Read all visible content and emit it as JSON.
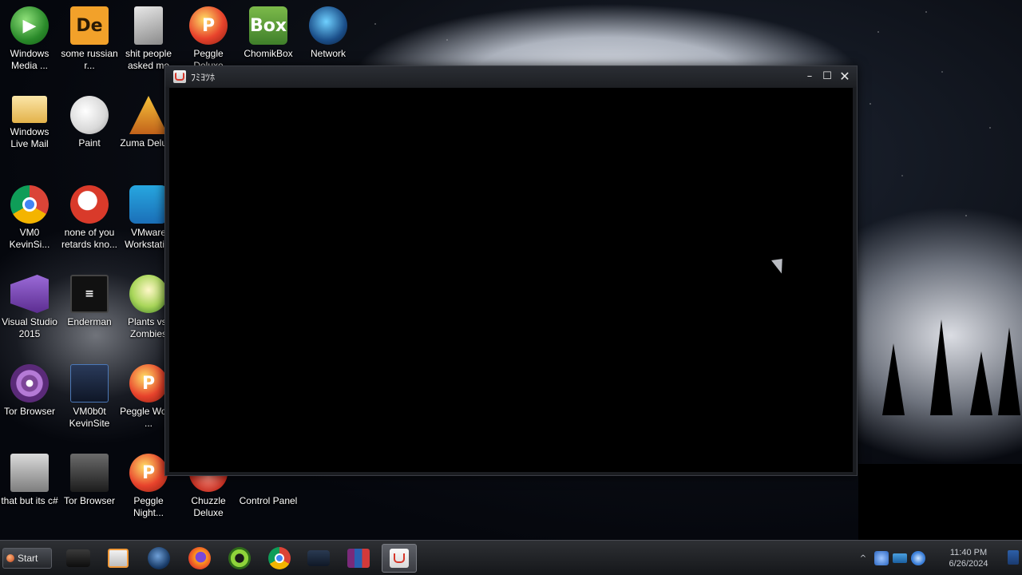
{
  "desktop": {
    "icons": [
      {
        "label": "Windows Media ...",
        "icon": "windows-media-player-icon"
      },
      {
        "label": "some russian r...",
        "icon": "de-app-icon"
      },
      {
        "label": "shit people asked me",
        "icon": "folder-icon"
      },
      {
        "label": "Peggle Deluxe",
        "icon": "peggle-icon"
      },
      {
        "label": "ChomikBox",
        "icon": "chomikbox-icon"
      },
      {
        "label": "Network",
        "icon": "network-icon"
      },
      {
        "label": "Windows Live Mail",
        "icon": "mail-icon"
      },
      {
        "label": "Paint",
        "icon": "paint-icon"
      },
      {
        "label": "Zuma Deluxe",
        "icon": "zuma-icon"
      },
      {
        "label": "VM0 KevinSi...",
        "icon": "chrome-icon"
      },
      {
        "label": "none of you retards kno...",
        "icon": "red-app-icon"
      },
      {
        "label": "VMware Workstati...",
        "icon": "vmware-icon"
      },
      {
        "label": "Visual Studio 2015",
        "icon": "visual-studio-icon"
      },
      {
        "label": "Enderman",
        "icon": "console-icon"
      },
      {
        "label": "Plants vs. Zombies",
        "icon": "plants-vs-zombies-icon"
      },
      {
        "label": "Tor Browser",
        "icon": "tor-icon"
      },
      {
        "label": "VM0b0t KevinSite",
        "icon": "vm-bot-icon"
      },
      {
        "label": "Peggle World ...",
        "icon": "peggle-icon"
      },
      {
        "label": "that but its c#",
        "icon": "copy-icon"
      },
      {
        "label": "Tor Browser",
        "icon": "tor-file-icon"
      },
      {
        "label": "Peggle Night...",
        "icon": "peggle-icon"
      },
      {
        "label": "Chuzzle Deluxe",
        "icon": "chuzzle-icon"
      },
      {
        "label": "Control Panel",
        "icon": "control-panel-icon"
      }
    ]
  },
  "window": {
    "title": "ﾌﾐﾖﾂﾎ",
    "minimize_label": "–",
    "maximize_label": "☐",
    "close_label": "✕"
  },
  "taskbar": {
    "start_label": "Start",
    "apps": [
      {
        "icon": "camera-icon"
      },
      {
        "icon": "media-player-icon"
      },
      {
        "icon": "globe-icon"
      },
      {
        "icon": "firefox-icon"
      },
      {
        "icon": "green-app-icon"
      },
      {
        "icon": "chrome-icon"
      },
      {
        "icon": "dark-app-icon"
      },
      {
        "icon": "winrar-icon"
      },
      {
        "icon": "java-icon",
        "active": true
      }
    ],
    "tray": {
      "expand_label": "^",
      "time": "11:40 PM",
      "date": "6/26/2024"
    }
  }
}
